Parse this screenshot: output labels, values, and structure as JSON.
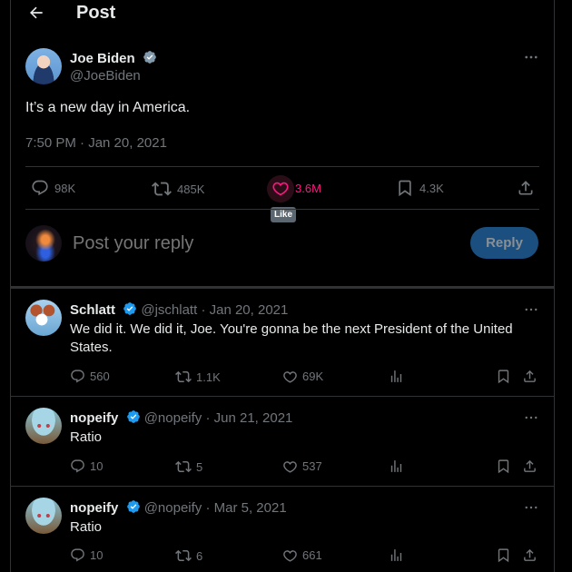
{
  "header": {
    "title": "Post",
    "back_icon": "arrow-left-icon"
  },
  "post": {
    "author_name": "Joe Biden",
    "author_handle": "@JoeBiden",
    "verified": "gray-verified-badge",
    "text": "It’s a new day in America.",
    "timestamp": "7:50 PM · Jan 20, 2021",
    "stats": {
      "replies": "98K",
      "reposts": "485K",
      "likes": "3.6M",
      "bookmarks": "4.3K"
    },
    "like_tooltip": "Like",
    "like_color": "#f91880"
  },
  "composer": {
    "placeholder": "Post your reply",
    "reply_button": "Reply",
    "reply_button_color": "#1a4f7f"
  },
  "replies": [
    {
      "name": "Schlatt",
      "handle": "@jschlatt",
      "date": "· Jan 20, 2021",
      "text": "We did it. We did it, Joe. You're gonna be the next President of the United States.",
      "replies": "560",
      "reposts": "1.1K",
      "likes": "69K"
    },
    {
      "name": "nopeify",
      "handle": "@nopeify",
      "date": "· Jun 21, 2021",
      "text": "Ratio",
      "replies": "10",
      "reposts": "5",
      "likes": "537"
    },
    {
      "name": "nopeify",
      "handle": "@nopeify",
      "date": "· Mar 5, 2021",
      "text": "Ratio",
      "replies": "10",
      "reposts": "6",
      "likes": "661"
    }
  ],
  "colors": {
    "background": "#000000",
    "border": "#2f3336",
    "muted": "#71767b",
    "verified_blue": "#1d9bf0"
  }
}
